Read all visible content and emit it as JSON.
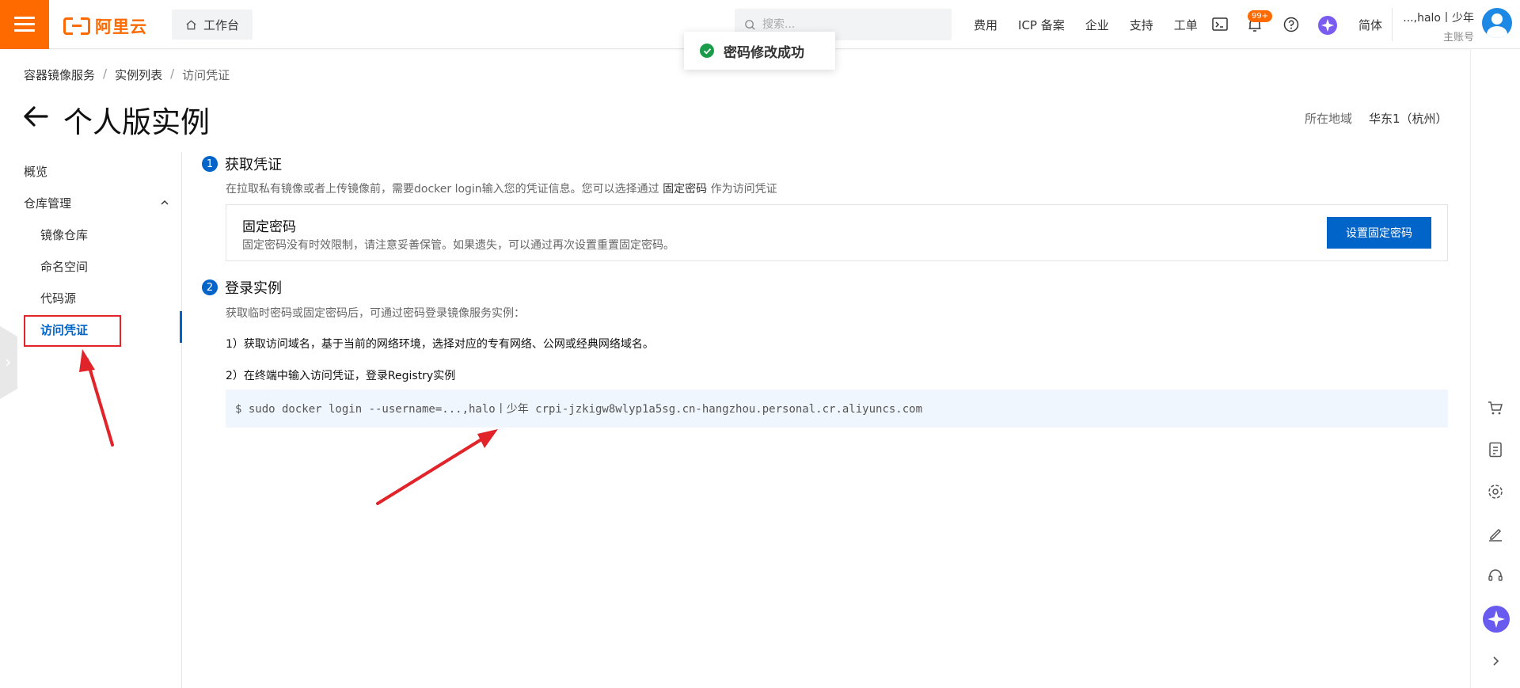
{
  "topbar": {
    "logo_text": "阿里云",
    "workbench_label": "工作台",
    "search_placeholder": "搜索...",
    "links": [
      "费用",
      "ICP 备案",
      "企业",
      "支持",
      "工单"
    ],
    "notification_badge": "99+",
    "language": "简体",
    "user_name": "...,halo丨少年",
    "user_role": "主账号"
  },
  "toast": {
    "message": "密码修改成功"
  },
  "breadcrumb": [
    "容器镜像服务",
    "实例列表",
    "访问凭证"
  ],
  "page": {
    "title": "个人版实例",
    "region_label": "所在地域",
    "region_value": "华东1（杭州）"
  },
  "leftnav": {
    "overview": "概览",
    "repo_mgmt": "仓库管理",
    "image_repo": "镜像仓库",
    "namespace": "命名空间",
    "code_source": "代码源",
    "access_credential": "访问凭证"
  },
  "step1": {
    "number": "1",
    "title": "获取凭证",
    "desc_before": "在拉取私有镜像或者上传镜像前，需要docker login输入您的凭证信息。您可以选择通过",
    "desc_highlight": "固定密码",
    "desc_after": "作为访问凭证",
    "card_title": "固定密码",
    "card_desc": "固定密码没有时效限制，请注意妥善保管。如果遗失，可以通过再次设置重置固定密码。",
    "button_label": "设置固定密码"
  },
  "step2": {
    "number": "2",
    "title": "登录实例",
    "desc": "获取临时密码或固定密码后，可通过密码登录镜像服务实例：",
    "line1": "1）获取访问域名，基于当前的网络环境，选择对应的专有网络、公网或经典网络域名。",
    "line2": "2）在终端中输入访问凭证，登录Registry实例",
    "command": "$ sudo docker login --username=...,halo丨少年 crpi-jzkigw8wlyp1a5sg.cn-hangzhou.personal.cr.aliyuncs.com"
  },
  "colors": {
    "brand": "#ff6a00",
    "primary": "#0064c8",
    "success": "#1a9c4a",
    "annotation": "#e0242a"
  }
}
